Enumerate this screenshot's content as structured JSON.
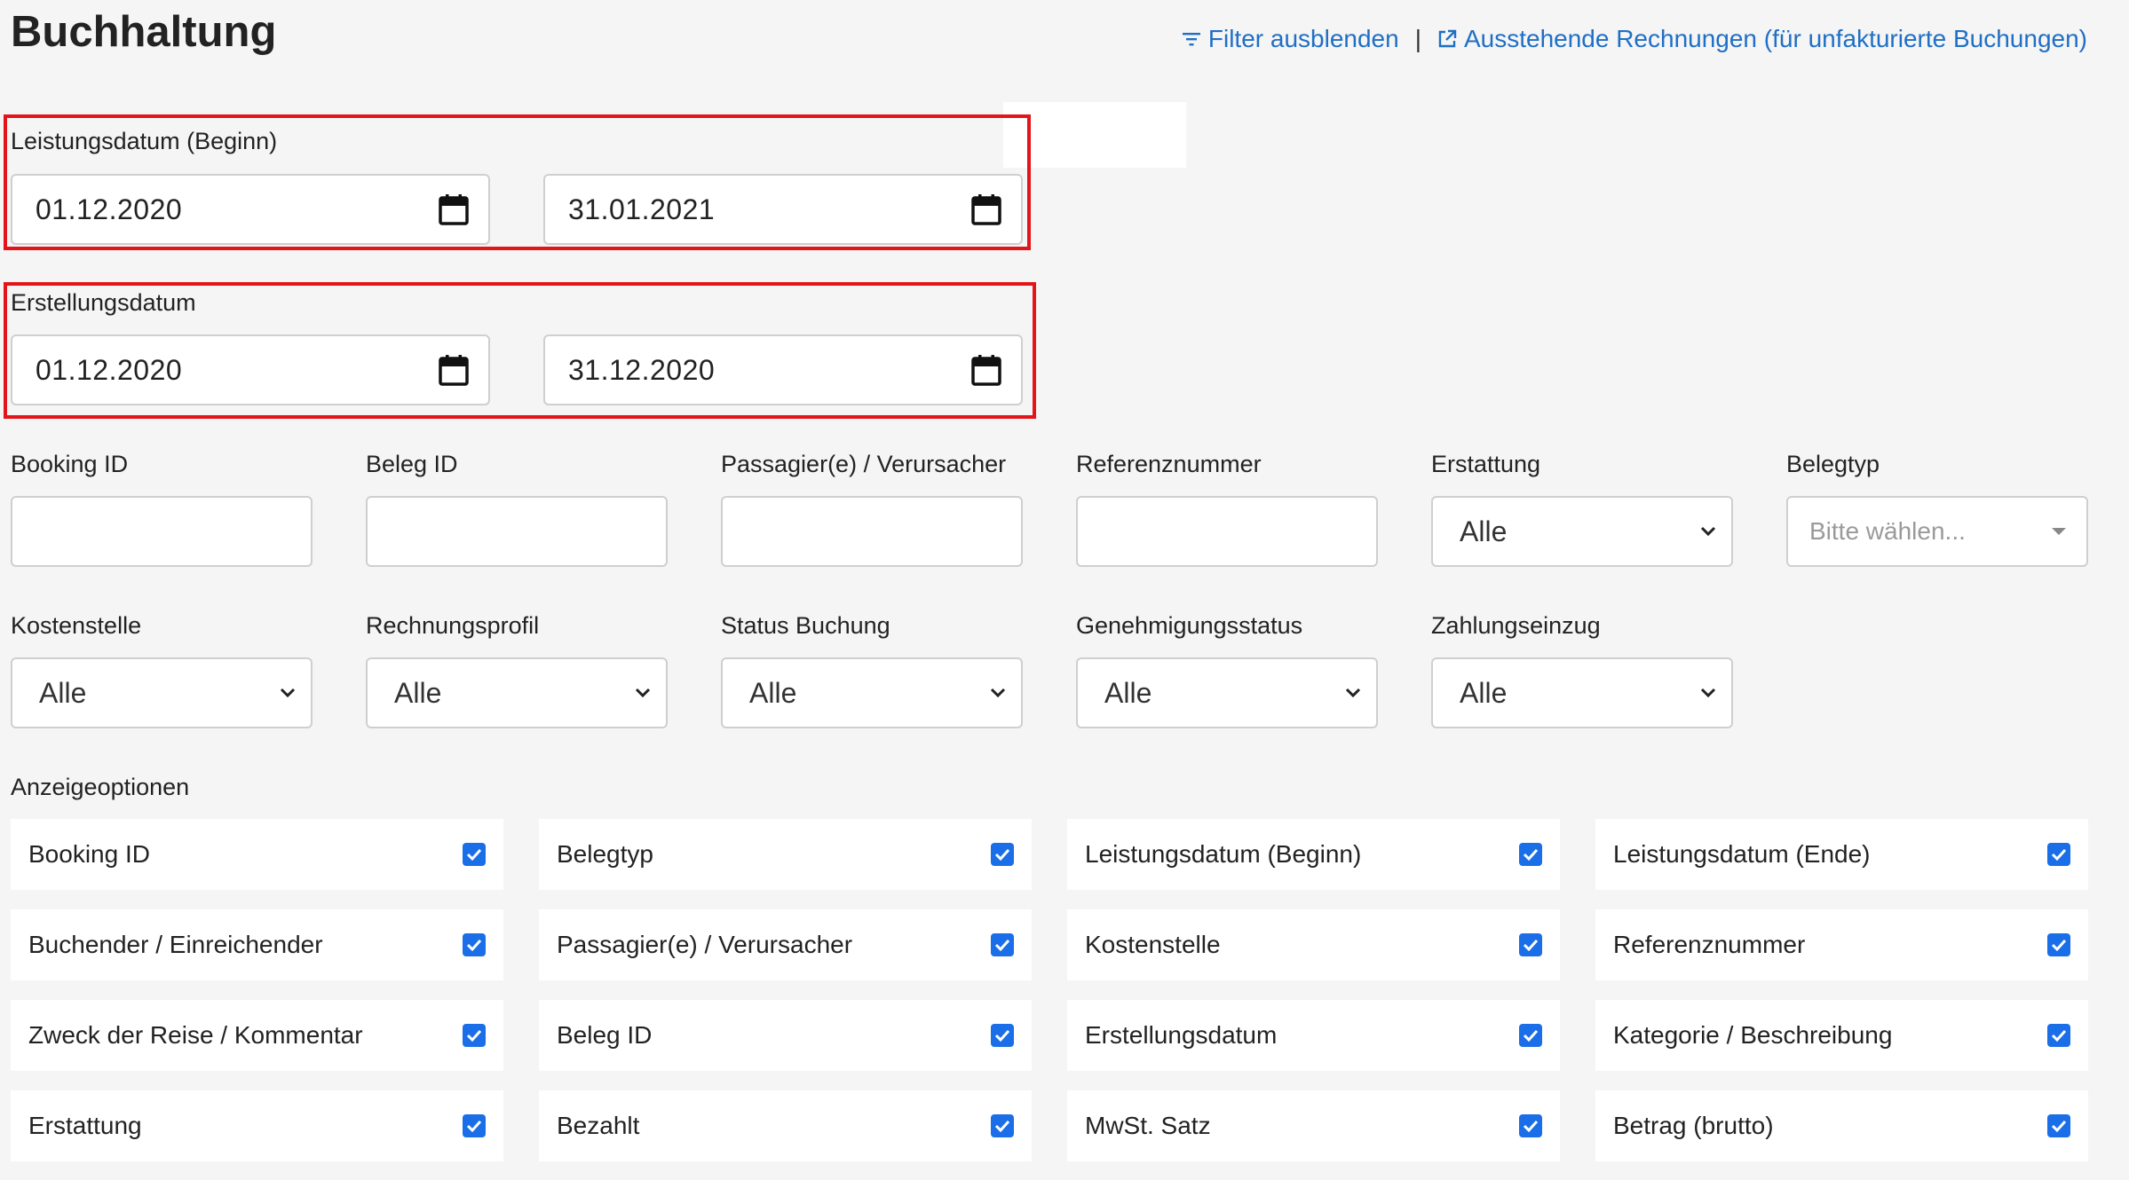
{
  "header": {
    "title": "Buchhaltung",
    "filter_link": "Filter ausblenden",
    "separator": "|",
    "pending_link": "Ausstehende Rechnungen (für unfakturierte Buchungen)"
  },
  "date_filters": {
    "service_date": {
      "label": "Leistungsdatum (Beginn)",
      "from": "01.12.2020",
      "to": "31.01.2021"
    },
    "creation_date": {
      "label": "Erstellungsdatum",
      "from": "01.12.2020",
      "to": "31.12.2020"
    }
  },
  "filters_row1": [
    {
      "label": "Booking ID",
      "type": "text",
      "value": ""
    },
    {
      "label": "Beleg ID",
      "type": "text",
      "value": ""
    },
    {
      "label": "Passagier(e) / Verursacher",
      "type": "text",
      "value": ""
    },
    {
      "label": "Referenznummer",
      "type": "text",
      "value": ""
    },
    {
      "label": "Erstattung",
      "type": "select",
      "value": "Alle"
    },
    {
      "label": "Belegtyp",
      "type": "multiselect",
      "placeholder": "Bitte wählen..."
    }
  ],
  "filters_row2": [
    {
      "label": "Kostenstelle",
      "value": "Alle"
    },
    {
      "label": "Rechnungsprofil",
      "value": "Alle"
    },
    {
      "label": "Status Buchung",
      "value": "Alle"
    },
    {
      "label": "Genehmigungsstatus",
      "value": "Alle"
    },
    {
      "label": "Zahlungseinzug",
      "value": "Alle"
    }
  ],
  "display_options": {
    "label": "Anzeigeoptionen",
    "rows": [
      [
        {
          "label": "Booking ID",
          "checked": true
        },
        {
          "label": "Belegtyp",
          "checked": true
        },
        {
          "label": "Leistungsdatum (Beginn)",
          "checked": true
        },
        {
          "label": "Leistungsdatum (Ende)",
          "checked": true
        }
      ],
      [
        {
          "label": "Buchender / Einreichender",
          "checked": true
        },
        {
          "label": "Passagier(e) / Verursacher",
          "checked": true
        },
        {
          "label": "Kostenstelle",
          "checked": true
        },
        {
          "label": "Referenznummer",
          "checked": true
        }
      ],
      [
        {
          "label": "Zweck der Reise / Kommentar",
          "checked": true
        },
        {
          "label": "Beleg ID",
          "checked": true
        },
        {
          "label": "Erstellungsdatum",
          "checked": true
        },
        {
          "label": "Kategorie / Beschreibung",
          "checked": true
        }
      ],
      [
        {
          "label": "Erstattung",
          "checked": true
        },
        {
          "label": "Bezahlt",
          "checked": true
        },
        {
          "label": "MwSt. Satz",
          "checked": true
        },
        {
          "label": "Betrag (brutto)",
          "checked": true
        }
      ]
    ]
  },
  "colors": {
    "link": "#1f6fc5",
    "checkbox": "#1a6ee8",
    "highlight": "#e3151a",
    "background": "#f5f5f5"
  }
}
